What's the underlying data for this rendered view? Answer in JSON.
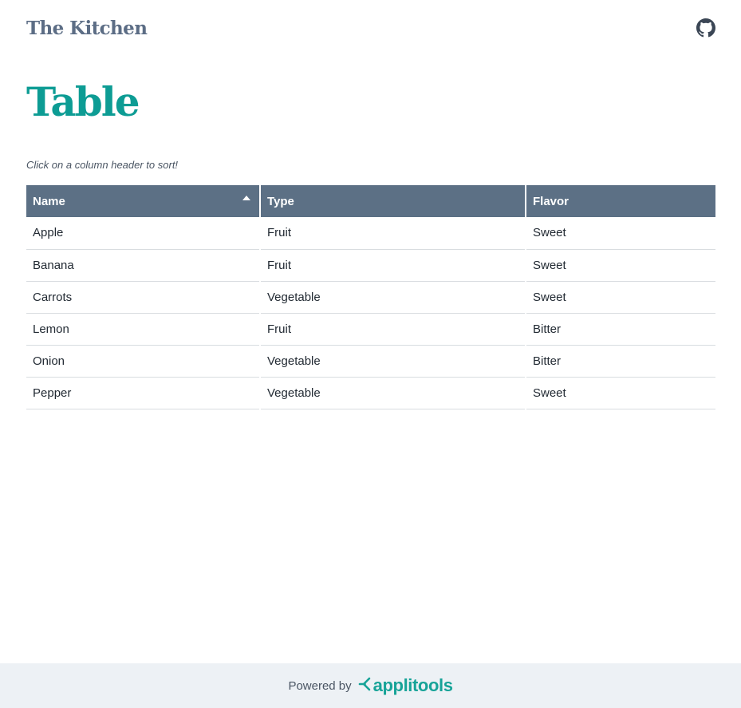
{
  "header": {
    "brand": "The Kitchen",
    "github_icon": "github-icon"
  },
  "page": {
    "title": "Table",
    "hint": "Click on a column header to sort!"
  },
  "table": {
    "sorted_column": "Name",
    "sort_direction": "ascending",
    "columns": [
      "Name",
      "Type",
      "Flavor"
    ],
    "rows": [
      [
        "Apple",
        "Fruit",
        "Sweet"
      ],
      [
        "Banana",
        "Fruit",
        "Sweet"
      ],
      [
        "Carrots",
        "Vegetable",
        "Sweet"
      ],
      [
        "Lemon",
        "Fruit",
        "Bitter"
      ],
      [
        "Onion",
        "Vegetable",
        "Bitter"
      ],
      [
        "Pepper",
        "Vegetable",
        "Sweet"
      ]
    ]
  },
  "footer": {
    "powered_by": "Powered by",
    "logo_text": "applitools",
    "logo_icon": "applitools-mark-icon"
  },
  "colors": {
    "brand": "#5c6d85",
    "title": "#0d9c94",
    "table_header_bg": "#5c7085",
    "footer_bg": "#edf1f5",
    "applitools": "#17a398"
  }
}
